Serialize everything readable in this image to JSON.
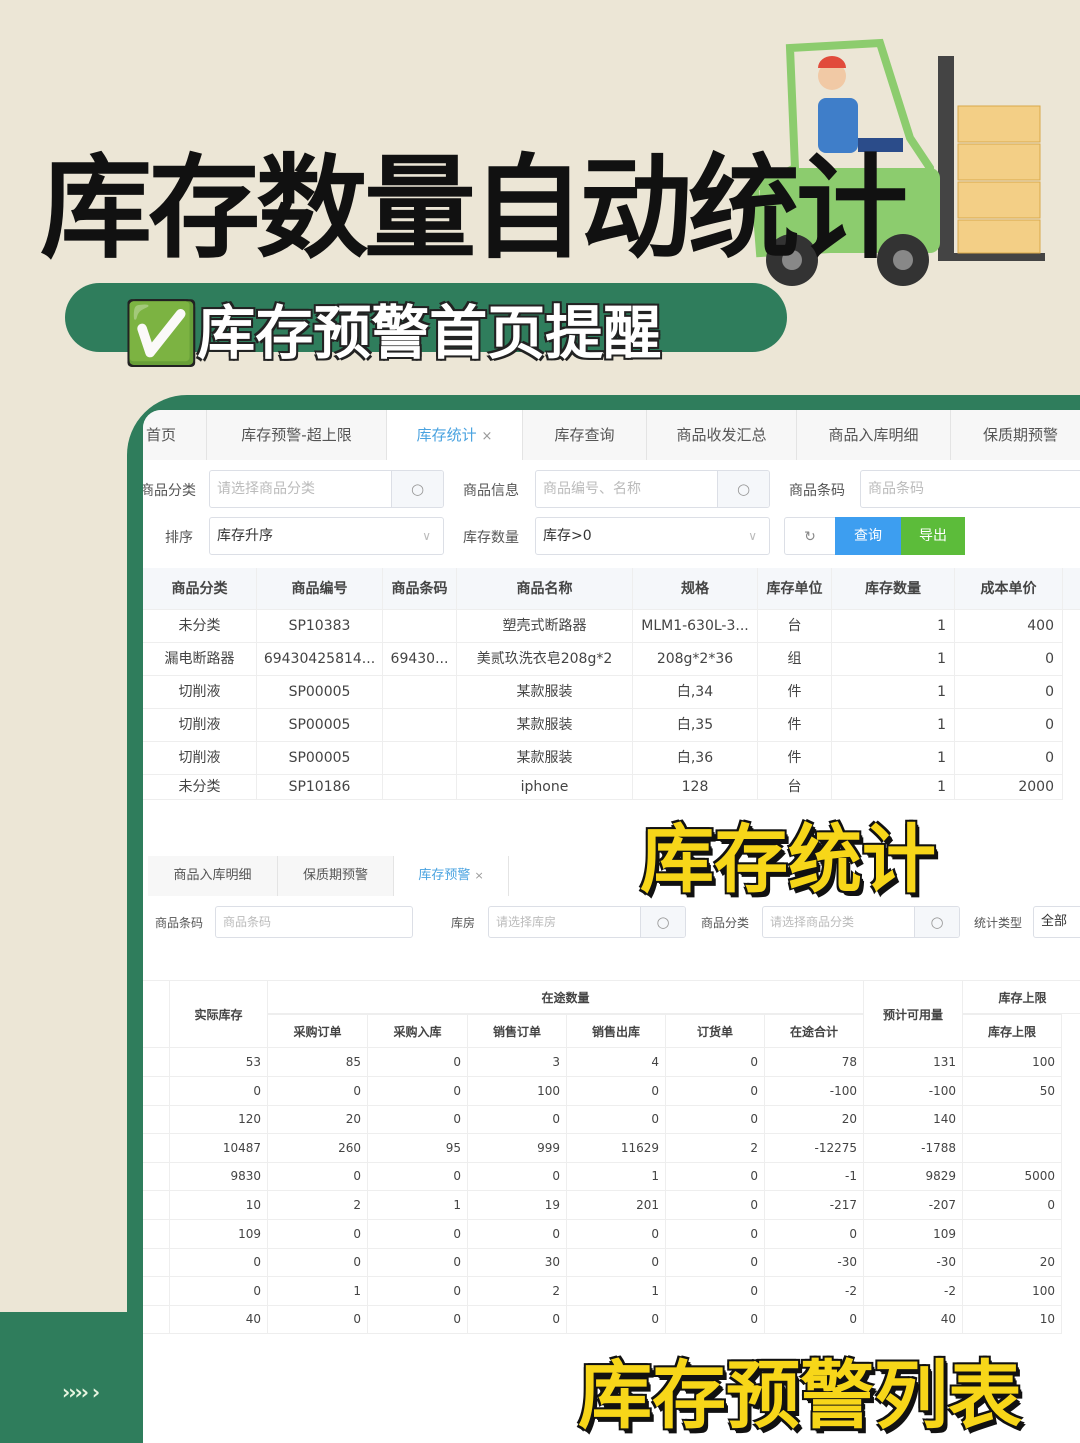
{
  "title": "库存数量自动统计",
  "subtitle": "✅库存预警首页提醒",
  "labels": {
    "stats": "库存统计",
    "warning_list": "库存预警列表"
  },
  "colors": {
    "brand_green": "#2f7d5c",
    "background": "#ece6d6",
    "highlight_yellow": "#f7d619",
    "tab_active": "#4aa3e0",
    "query_button": "#3d9ef0",
    "export_button": "#5cbc3a"
  },
  "footer_arrows": "›››› ›",
  "top": {
    "tabs": [
      {
        "label": "首页"
      },
      {
        "label": "库存预警-超上限"
      },
      {
        "label": "库存统计",
        "active": true,
        "close": "×"
      },
      {
        "label": "库存查询"
      },
      {
        "label": "商品收发汇总"
      },
      {
        "label": "商品入库明细"
      },
      {
        "label": "保质期预警"
      }
    ],
    "filters": {
      "category": {
        "label": "商品分类",
        "placeholder": "请选择商品分类"
      },
      "info": {
        "label": "商品信息",
        "placeholder": "商品编号、名称"
      },
      "barcode": {
        "label": "商品条码",
        "placeholder": "商品条码"
      },
      "sort": {
        "label": "排序",
        "value": "库存升序"
      },
      "qty": {
        "label": "库存数量",
        "value": "库存>0"
      },
      "refresh_icon": "refresh-icon",
      "query": "查询",
      "export": "导出"
    },
    "columns": [
      "商品分类",
      "商品编号",
      "商品条码",
      "商品名称",
      "规格",
      "库存单位",
      "库存数量",
      "成本单价"
    ],
    "rows": [
      [
        "未分类",
        "SP10383",
        "",
        "塑壳式断路器",
        "MLM1-630L-3...",
        "台",
        "1",
        "400"
      ],
      [
        "漏电断路器",
        "69430425814...",
        "69430...",
        "美贰玖洗衣皂208g*2",
        "208g*2*36",
        "组",
        "1",
        "0"
      ],
      [
        "切削液",
        "SP00005",
        "",
        "某款服装",
        "白,34",
        "件",
        "1",
        "0"
      ],
      [
        "切削液",
        "SP00005",
        "",
        "某款服装",
        "白,35",
        "件",
        "1",
        "0"
      ],
      [
        "切削液",
        "SP00005",
        "",
        "某款服装",
        "白,36",
        "件",
        "1",
        "0"
      ],
      [
        "未分类",
        "SP10186",
        "",
        "iphone",
        "128",
        "台",
        "1",
        "2000"
      ]
    ]
  },
  "bottom": {
    "tabs": [
      {
        "label": "商品入库明细"
      },
      {
        "label": "保质期预警"
      },
      {
        "label": "库存预警",
        "active": true,
        "close": "×"
      }
    ],
    "filters": {
      "barcode": {
        "label": "商品条码",
        "placeholder": "商品条码"
      },
      "warehouse": {
        "label": "库房",
        "placeholder": "请选择库房"
      },
      "category": {
        "label": "商品分类",
        "placeholder": "请选择商品分类"
      },
      "stat_type": {
        "label": "统计类型",
        "value": "全部"
      }
    },
    "header": {
      "actual": "实际库存",
      "in_transit": "在途数量",
      "sub": [
        "采购订单",
        "采购入库",
        "销售订单",
        "销售出库",
        "订货单",
        "在途合计"
      ],
      "expected": "预计可用量",
      "upper_group": "库存上限",
      "upper": "库存上限"
    },
    "rows": [
      [
        "53",
        "85",
        "0",
        "3",
        "4",
        "0",
        "78",
        "131",
        "100"
      ],
      [
        "0",
        "0",
        "0",
        "100",
        "0",
        "0",
        "-100",
        "-100",
        "50"
      ],
      [
        "120",
        "20",
        "0",
        "0",
        "0",
        "0",
        "20",
        "140",
        ""
      ],
      [
        "10487",
        "260",
        "95",
        "999",
        "11629",
        "2",
        "-12275",
        "-1788",
        ""
      ],
      [
        "9830",
        "0",
        "0",
        "0",
        "1",
        "0",
        "-1",
        "9829",
        "5000"
      ],
      [
        "10",
        "2",
        "1",
        "19",
        "201",
        "0",
        "-217",
        "-207",
        "0"
      ],
      [
        "109",
        "0",
        "0",
        "0",
        "0",
        "0",
        "0",
        "109",
        ""
      ],
      [
        "0",
        "0",
        "0",
        "30",
        "0",
        "0",
        "-30",
        "-30",
        "20"
      ],
      [
        "0",
        "1",
        "0",
        "2",
        "1",
        "0",
        "-2",
        "-2",
        "100"
      ],
      [
        "40",
        "0",
        "0",
        "0",
        "0",
        "0",
        "0",
        "40",
        "10"
      ]
    ]
  }
}
